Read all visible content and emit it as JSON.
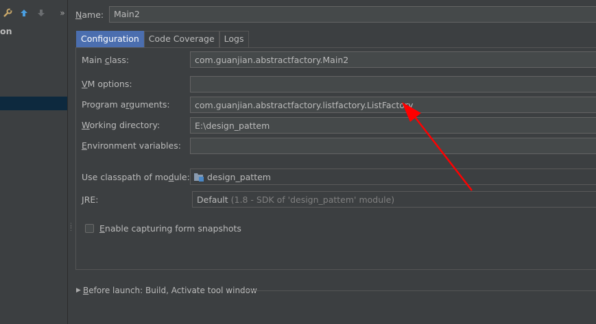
{
  "left_panel": {
    "tree_node_label": "on",
    "toolbar_icons": [
      "wrench-icon",
      "arrow-up-icon",
      "arrow-down-icon",
      "chevron-double-right-icon"
    ],
    "more_glyph": "»"
  },
  "name": {
    "label_first": "N",
    "label_rest": "ame:",
    "value": "Main2"
  },
  "tabs": [
    {
      "label": "Configuration",
      "active": true
    },
    {
      "label": "Code Coverage",
      "active": false
    },
    {
      "label": "Logs",
      "active": false
    }
  ],
  "fields": {
    "main_class": {
      "label_pre": "Main ",
      "label_u": "c",
      "label_post": "lass:",
      "value": "com.guanjian.abstractfactory.Main2"
    },
    "vm_options": {
      "label_pre": "",
      "label_u": "V",
      "label_post": "M options:",
      "value": ""
    },
    "program_arguments": {
      "label_pre": "Program a",
      "label_u": "r",
      "label_post": "guments:",
      "value": "com.guanjian.abstractfactory.listfactory.ListFactory"
    },
    "working_directory": {
      "label_pre": "",
      "label_u": "W",
      "label_post": "orking directory:",
      "value": "E:\\design_pattem"
    },
    "environment_variables": {
      "label_pre": "",
      "label_u": "E",
      "label_post": "nvironment variables:",
      "value": ""
    },
    "classpath_module": {
      "label_pre": "Use classpath of mo",
      "label_u": "d",
      "label_post": "ule:",
      "value": "design_pattem"
    },
    "jre": {
      "label_pre": "",
      "label_u": "J",
      "label_post": "RE:",
      "value": "Default",
      "hint": "(1.8 - SDK of 'design_pattem' module)"
    }
  },
  "checkbox": {
    "label_u": "E",
    "label_rest": "nable capturing form snapshots",
    "checked": false
  },
  "before_launch": {
    "label_u": "B",
    "label_rest": "efore launch: Build, Activate tool window"
  },
  "colors": {
    "background": "#3c3f41",
    "input_bg": "#45494a",
    "text": "#bbbbbb",
    "tab_active": "#4b6eaf",
    "selection": "#0d293e",
    "annotation": "#ff0000"
  }
}
